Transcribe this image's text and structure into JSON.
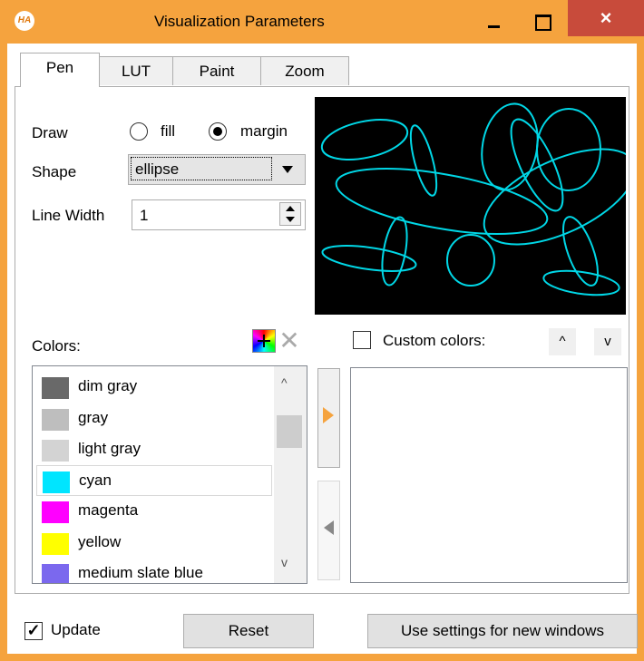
{
  "window": {
    "title": "Visualization Parameters",
    "icon_text": "HA",
    "close_symbol": "×"
  },
  "tabs": [
    {
      "label": "Pen",
      "active": true
    },
    {
      "label": "LUT",
      "active": false
    },
    {
      "label": "Paint",
      "active": false
    },
    {
      "label": "Zoom",
      "active": false
    }
  ],
  "pen": {
    "draw_label": "Draw",
    "draw_options": [
      {
        "label": "fill",
        "checked": false
      },
      {
        "label": "margin",
        "checked": true
      }
    ],
    "shape_label": "Shape",
    "shape_value": "ellipse",
    "line_width_label": "Line Width",
    "line_width_value": "1"
  },
  "colors": {
    "label": "Colors:",
    "items": [
      {
        "name": "dim gray",
        "color": "#696969"
      },
      {
        "name": "gray",
        "color": "#bebebe"
      },
      {
        "name": "light gray",
        "color": "#d3d3d3"
      },
      {
        "name": "cyan",
        "color": "#00e5ff",
        "selected": true
      },
      {
        "name": "magenta",
        "color": "#ff00ff"
      },
      {
        "name": "yellow",
        "color": "#ffff00"
      },
      {
        "name": "medium slate blue",
        "color": "#7b68ee"
      }
    ],
    "scroll_up": "^",
    "scroll_down": "v"
  },
  "custom_colors": {
    "label": "Custom colors:",
    "checked": false,
    "up_symbol": "^",
    "down_symbol": "v"
  },
  "footer": {
    "update_label": "Update",
    "update_checked": true,
    "update_check_symbol": "✓",
    "reset_label": "Reset",
    "use_settings_label": "Use settings for new windows"
  },
  "preview": {
    "background": "#000000",
    "stroke": "#00d7e6"
  },
  "accent_color": "#f5a33e",
  "close_color": "#c84b3b"
}
